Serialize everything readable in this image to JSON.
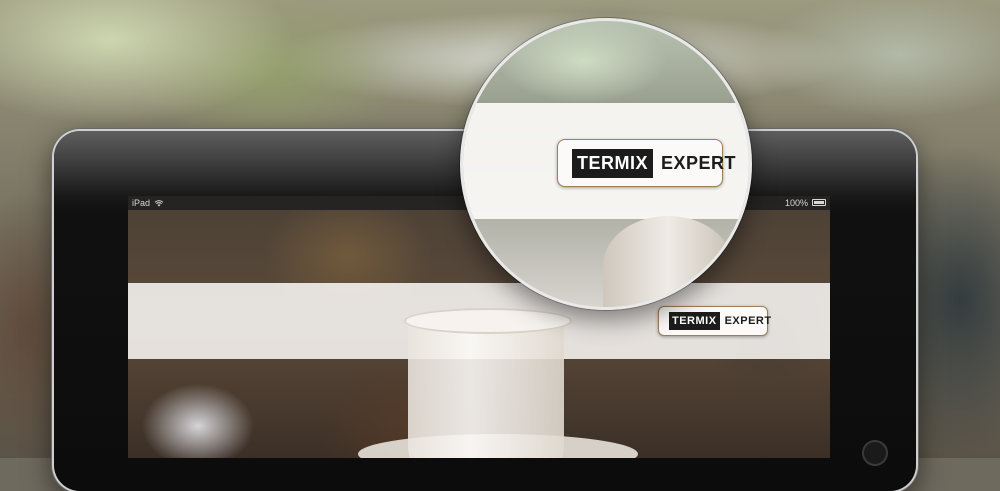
{
  "statusbar": {
    "device": "iPad",
    "battery": "100%",
    "wifi_icon": "wifi-icon",
    "battery_icon": "battery-icon"
  },
  "logo": {
    "termix": "TERMIX",
    "expert": "EXPERT"
  },
  "colors": {
    "logo_dark": "#1c1c1c",
    "logo_border": "#9c8155",
    "banner": "#f8f6f4"
  }
}
